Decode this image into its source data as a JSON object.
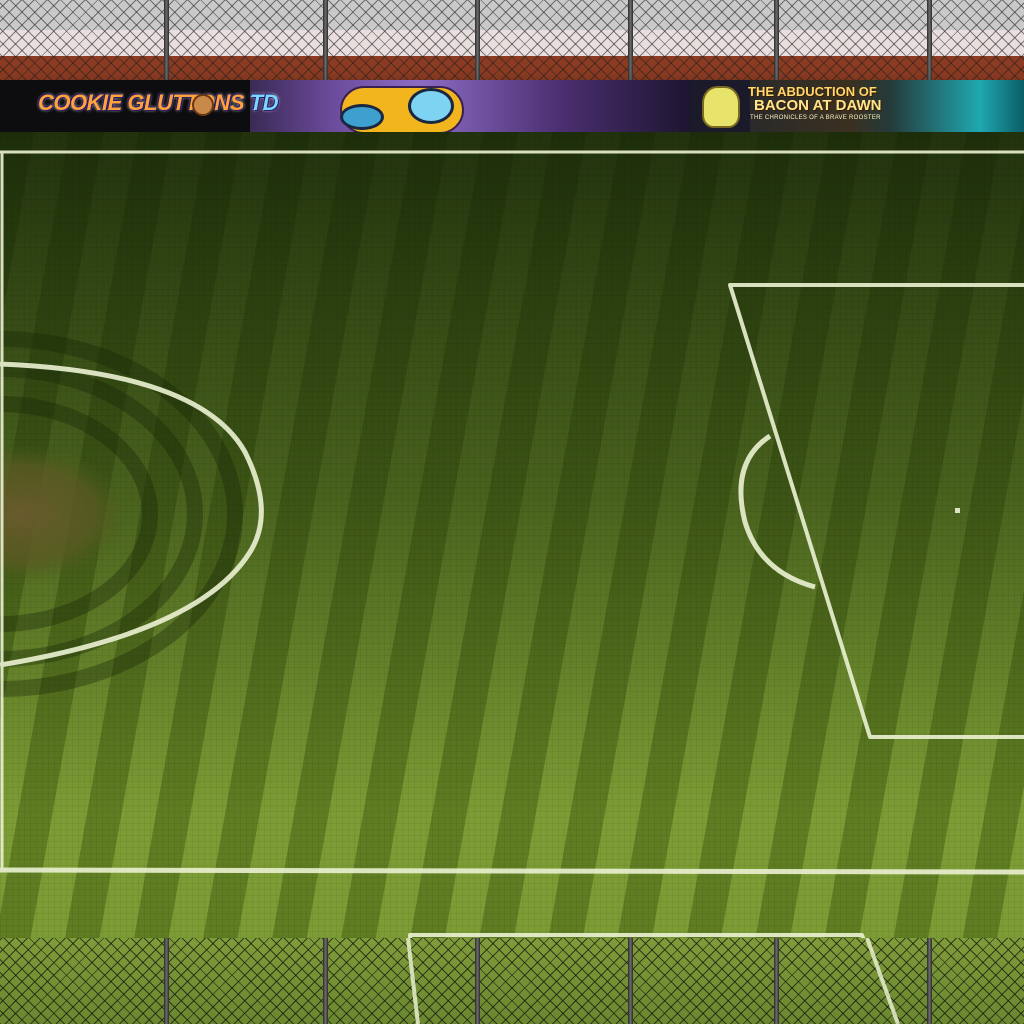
{
  "ads": {
    "left": {
      "logo_main": "COOKIE GLUTTONS",
      "logo_suffix": "TD"
    },
    "right": {
      "title_line1": "THE ABDUCTION OF",
      "title_line2": "BACON AT DAWN",
      "subtitle": "THE CHRONICLES OF A BRAVE ROOSTER"
    }
  },
  "colors": {
    "pitch_light": "#7c9d35",
    "pitch_dark": "#5f7d22",
    "line_white": "#e8efcf",
    "dirt_spot": "#6b5a2e",
    "banner_accent": "#ffa23a"
  },
  "icons": [
    "chain-link-fence",
    "fence-post",
    "cookie-icon",
    "rooster-character"
  ]
}
